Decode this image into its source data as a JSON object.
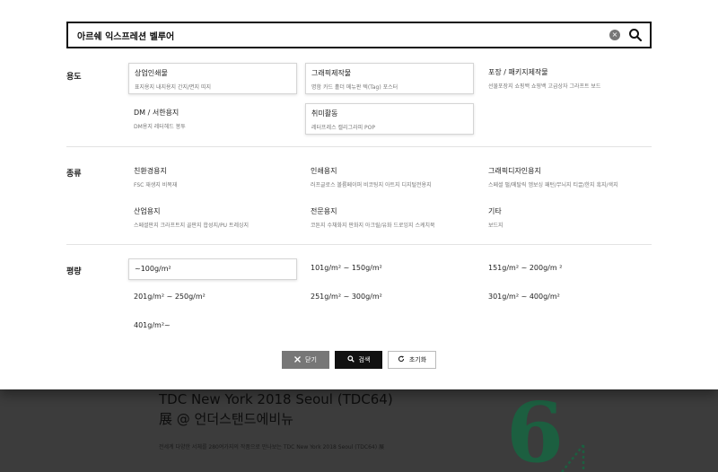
{
  "search": {
    "value": "아르쉐 익스프레션 벨루어",
    "clear_icon": "×",
    "search_icon": "search-icon"
  },
  "sections": {
    "usage": {
      "label": "용도",
      "options": [
        {
          "title": "상업인쇄물",
          "sub": "표지용지 내지용지 간지/면지 띠지",
          "selected": true
        },
        {
          "title": "그래픽제작물",
          "sub": "명함 카드 홀더 메뉴판 텍(Tag) 포스터",
          "selected": true
        },
        {
          "title": "포장 / 패키지제작물",
          "sub": "선물포장지 쇼핑백 쇼핑백 고급상자 그라프트 보드",
          "selected": false
        },
        {
          "title": "DM / 서한용지",
          "sub": "DM용지 레터헤드 봉투",
          "selected": false
        },
        {
          "title": "취미활동",
          "sub": "레터프레스 캘리그라피 POP",
          "selected": true
        }
      ]
    },
    "type": {
      "label": "종류",
      "options": [
        {
          "title": "친환경용지",
          "sub": "FSC 재생지 비목재"
        },
        {
          "title": "인쇄용지",
          "sub": "러프글로스 볼륨페이퍼 비코팅지 아트지 디지털전용지"
        },
        {
          "title": "그래픽디자인용지",
          "sub": "스페셜 펄/메탈릭 엠보싱 패턴/무늬지 티끌/한지 흑지/색지"
        },
        {
          "title": "산업용지",
          "sub": "스페셜판지 크라프트지 골판지 합성지/PU 트레싱지"
        },
        {
          "title": "전문용지",
          "sub": "코튼지 수채화지 판화지 아크릴/유화 드로잉지 스케치북"
        },
        {
          "title": "기타",
          "sub": "보드지"
        }
      ]
    },
    "weight": {
      "label": "평량",
      "options": [
        {
          "label": "~100g/m²",
          "selected": true
        },
        {
          "label": "101g/m² ~ 150g/m²",
          "selected": false
        },
        {
          "label": "151g/m² ~ 200g/m ²",
          "selected": false
        },
        {
          "label": "201g/m² ~ 250g/m²",
          "selected": false
        },
        {
          "label": "251g/m² ~ 300g/m²",
          "selected": false
        },
        {
          "label": "301g/m² ~ 400g/m²",
          "selected": false
        },
        {
          "label": "401g/m²~",
          "selected": false
        }
      ]
    }
  },
  "actions": {
    "close_label": "닫기",
    "search_label": "검색",
    "reset_label": "초기화"
  },
  "background": {
    "title_line1": "TDC New York 2018 Seoul (TDC64)",
    "title_line2": "展 @ 언더스탠드에비뉴",
    "description": "전세계 다양한 서체를 280여가지의 작품으로 만나보는 TDC New York 2018 Seoul (TDC64) 展",
    "art_text": "6",
    "accent_color": "#1f8a5a"
  }
}
